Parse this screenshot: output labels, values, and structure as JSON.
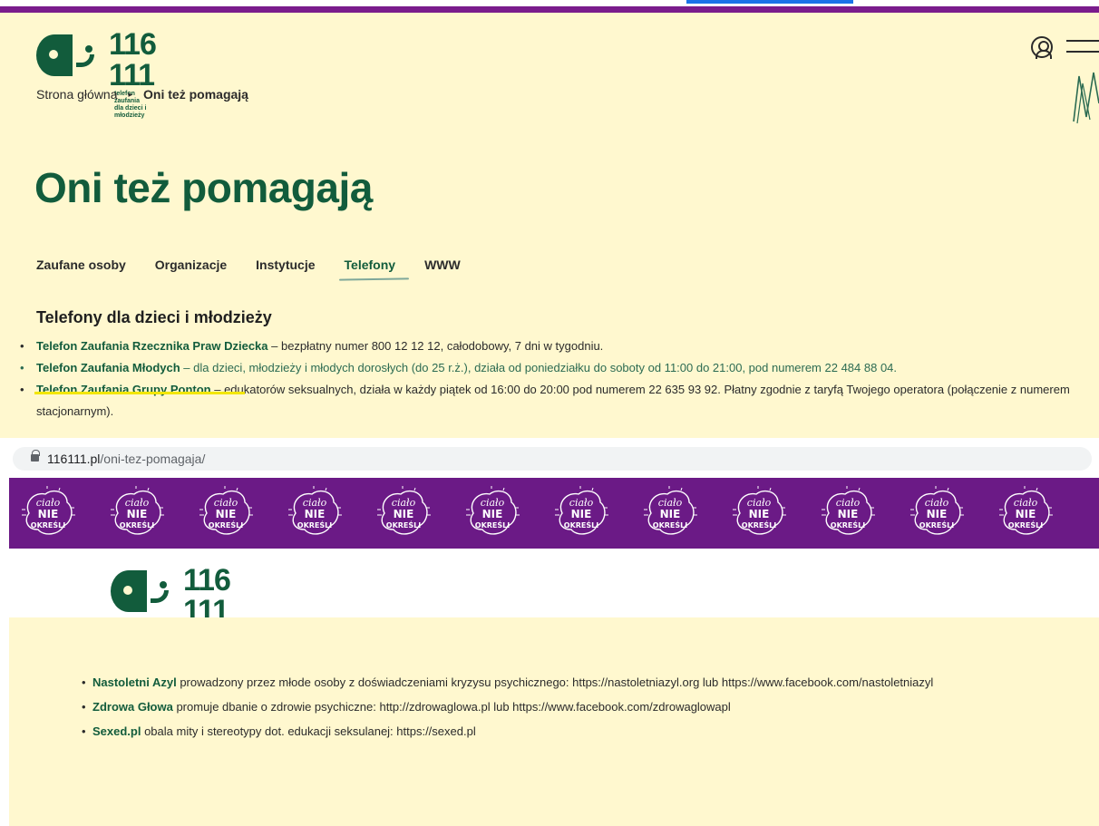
{
  "brand": {
    "number": "116 111",
    "tagline_line1": "telefon zaufania",
    "tagline_line2": "dla dzieci i młodzieży"
  },
  "breadcrumb": {
    "home": "Strona główna",
    "separator": "▸",
    "current": "Oni też pomagają"
  },
  "page": {
    "title": "Oni też pomagają"
  },
  "tabs": [
    {
      "label": "Zaufane osoby"
    },
    {
      "label": "Organizacje"
    },
    {
      "label": "Instytucje"
    },
    {
      "label": "Telefony",
      "active": true
    },
    {
      "label": "WWW"
    }
  ],
  "phones": {
    "heading": "Telefony dla dzieci i młodzieży",
    "items": [
      {
        "name": "Telefon Zaufania Rzecznika Praw Dziecka",
        "text": " – bezpłatny numer 800 12 12 12, całodobowy, 7 dni w tygodniu."
      },
      {
        "name": "Telefon Zaufania Młodych",
        "text": " – dla dzieci, młodzieży i młodych dorosłych (do 25 r.ż.), działa od poniedziałku do soboty od 11:00 do 21:00, pod numerem 22 484 88 04."
      },
      {
        "name": "Telefon Zaufania Grupy Ponton",
        "text": " – edukatorów seksualnych, działa w każdy piątek od 16:00 do 20:00 pod numerem 22 635 93 92. Płatny zgodnie z taryfą Twojego operatora (połączenie z numerem stacjonarnym)."
      }
    ]
  },
  "browser": {
    "domain": "116111.pl",
    "path": "/oni-tez-pomagaja/"
  },
  "banner": {
    "badge_line1": "ciało",
    "badge_line2": "NIE",
    "badge_line3": "OKREŚLI"
  },
  "www": {
    "items": [
      {
        "name": "Nastoletni Azyl",
        "text": " prowadzony przez młode osoby z doświadczeniami kryzysu psychicznego: https://nastoletniazyl.org lub https://www.facebook.com/nastoletniazyl"
      },
      {
        "name": "Zdrowa Głowa",
        "text": " promuje dbanie o zdrowie psychiczne: http://zdrowaglowa.pl lub https://www.facebook.com/zdrowaglowapl"
      },
      {
        "name": "Sexed.pl",
        "text": " obala mity i stereotypy dot. edukacji seksulanej: https://sexed.pl"
      }
    ]
  },
  "colors": {
    "brand_green": "#125c3c",
    "page_bg": "#fff8cf",
    "banner_purple": "#6b1a86",
    "highlight_yellow": "#f2e600"
  }
}
